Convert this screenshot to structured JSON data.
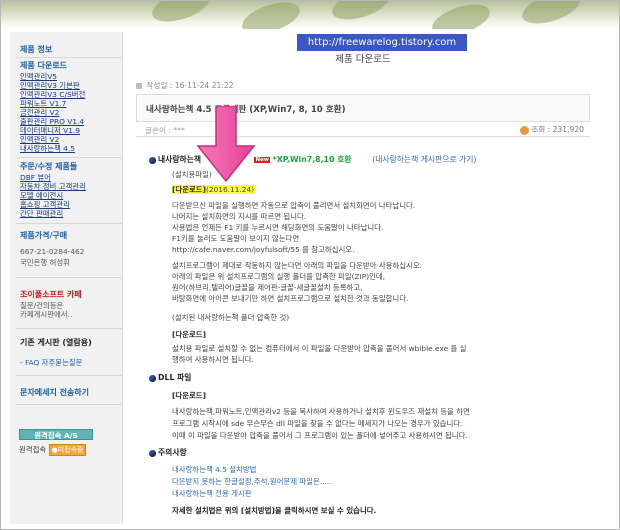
{
  "sidebar": {
    "product_info_title": "제품 정보",
    "download_title": "제품 다운로드",
    "download_items": [
      "인맥관리V5",
      "인맥관리V3 기본판",
      "인맥관리V3 C/S버전",
      "파워노트 V1.7",
      "금전관리 V2",
      "출판관리 PRO V1.4",
      "데이터매니저 V1.9",
      "인맥관리 V2",
      "내사랑하는책 4.5"
    ],
    "custom_title": "주문/수정 제품들",
    "custom_items": [
      "DBF 뷰어",
      "자동차 정비 고객관리",
      "모델 에이전시",
      "홈쇼핑 고객관리",
      "간단 판매관리"
    ],
    "price_title": "제품가격/구매",
    "phone": "667-21-0284-462",
    "bank": "국민은행 허성휘",
    "cafe_title": "조이풀소프트 카페",
    "cafe_desc_1": "질문/건의등은",
    "cafe_desc_2": "카페게시판에서..",
    "board_title": "기존 게시판 (열람용)",
    "faq_link": "- FAQ 자주묻는질문",
    "message_title": "문자메세지 전송하기",
    "visit_button": "원격접속 A/S",
    "online_label": "원격접속",
    "not_connected": "미접속중",
    "not_connected_icon": "●"
  },
  "main": {
    "title": "제품 다운로드",
    "date": "작성일 : 16-11-24 21:22",
    "watermark": "http://freewarelog.tistory.com",
    "subject": "내사랑하는책 4.5 고급계판 (XP,Win7, 8, 10 호환)",
    "author": "글쓴이 : ***",
    "views": "조회 : 231,920",
    "heading_title": "내사랑하는책",
    "heading_new": "New",
    "heading_compat": "*XP,Win7,8,10 호환",
    "heading_link": "(내사랑하는책 게시판으로 가기)",
    "setup_label": "(설치용파일)",
    "download_link": "[다운로드]",
    "download_date": "(2016.11.24)",
    "desc_lines": [
      "다운받으신 파일을 실행하면 자동으로 압축이 풀리면서 설치화면이 나타납니다.",
      "나머지는 설치화면의 지시를 따르면 됩니다.",
      "사용법은 언제든 F1 키를 누르시면 해당화면의 도움말이 나타납니다.",
      "F1키를 눌러도 도움말이 보이지 않는다면",
      "http://cafe.naver.com/joyfulsoft/55 를 참고하십시오."
    ],
    "desc_lines_2": [
      "설치프로그램이 제대로 작동하지 않는다면 아래의 파일을 다운받아 사용하십시오.",
      "아래의 파일은 위 설치프로그램의 실행 폴더를 압축한 파일(ZIP)인데,",
      "원어(하브리,텔리어)글꼴을 제어판-글꼴-새글꼴설치 등록하고,",
      "바탕화면에 아이콘 보내기만 하면 설치프로그램으로 설치한 것과 동일합니다."
    ],
    "zip_label": "(설치된 내사랑하는책 폴더 압축한 것)",
    "zip_download": "[다운로드]",
    "zip_desc_1": "설치용 파일로 설치할 수 없는 컴퓨터에서 이 파일을 다운받아 압축을 풀어서 wbible.exe 를 실",
    "zip_desc_2": "행하여 사용하시면 됩니다.",
    "dll_title": "DLL 파일",
    "dll_download": "[다운로드]",
    "dll_desc": [
      "내사랑하는책,파워노트,인맥관리v2 등을 복사하여 사용하거나 설치후 윈도우즈 재설치 등을 하면",
      "프로그램 시작시에 sde 무슨무슨 dll 파일을 찾을 수 없다는 메세지가 나오는 경우가 있습니다.",
      "이때 이 파일을 다운받아 압축을 풀어서 그 프로그램이 있는 폴더에 넣어주고 사용하시면 됩니다."
    ],
    "notes_title": "주의사항",
    "notes_links": [
      "내사랑하는책 4.5 설치방법",
      "다운받지 못하는 한글설정,주석,원어문제 파일은.....",
      "내사랑하는책 전용 게시판"
    ],
    "footer_note": "자세한 설치법은 위의 [설치방법]을 클릭하시면 보실 수 있습니다."
  },
  "colors": {
    "accent_blue": "#1f5fa8",
    "watermark_bg": "#3b56c9",
    "arrow_pink": "#f05aa8",
    "highlight_yellow": "#ffff3f",
    "compat_green": "#17a73c"
  }
}
